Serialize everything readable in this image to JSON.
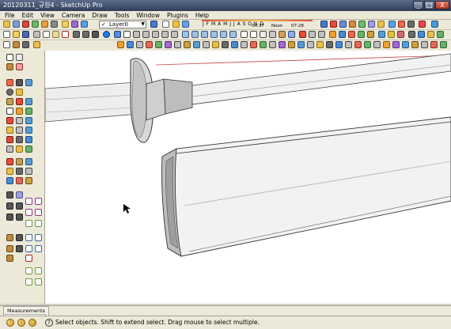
{
  "window": {
    "title": "20120311_규원4 - SketchUp Pro",
    "minimize": "_",
    "maximize": "□",
    "close": "X"
  },
  "menu": [
    "File",
    "Edit",
    "View",
    "Camera",
    "Draw",
    "Tools",
    "Window",
    "Plugins",
    "Help"
  ],
  "layer": {
    "value": "Layer0",
    "check": "✓",
    "arrow": "▼"
  },
  "shadow": {
    "months": "J F M A M J J A S O N D",
    "time_start": "04:37",
    "noon": "Noon",
    "time_end": "07:28"
  },
  "measurements": {
    "label": "Measurements",
    "value": ""
  },
  "status": {
    "message": "Select objects. Shift to extend select. Drag mouse to select multiple.",
    "help_icon": "?",
    "btn1": "!",
    "btn2": "i",
    "btn3": "○"
  },
  "colors": {
    "accent": "#e64a3c",
    "viewport": "#ffffff",
    "chrome": "#ece9d8",
    "model_face": "#f2f2f2",
    "model_dark": "#bdbdbd",
    "red_axis": "#c8424a"
  }
}
